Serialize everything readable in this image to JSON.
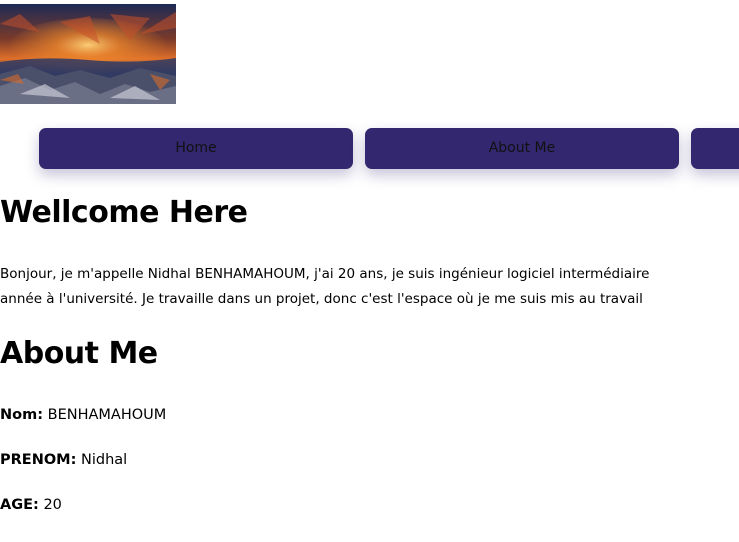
{
  "hero": {
    "image_description_icon": "sunset-seascape-image"
  },
  "nav": {
    "items": [
      {
        "label": "Home"
      },
      {
        "label": "About Me"
      },
      {
        "label": ""
      }
    ],
    "button_color": "#33276f"
  },
  "welcome": {
    "title": "Wellcome Here",
    "intro_line1": "Bonjour, je m'appelle Nidhal BENHAMAHOUM, j'ai 20 ans, je suis ingénieur logiciel intermédiaire",
    "intro_line2": "année à l'université. Je travaille dans un projet, donc c'est l'espace où je me suis mis au travail"
  },
  "about": {
    "title": "About Me",
    "fields": [
      {
        "label": "Nom:",
        "value": "BENHAMAHOUM"
      },
      {
        "label": "PRENOM:",
        "value": "Nidhal"
      },
      {
        "label": "AGE:",
        "value": "20"
      }
    ]
  }
}
